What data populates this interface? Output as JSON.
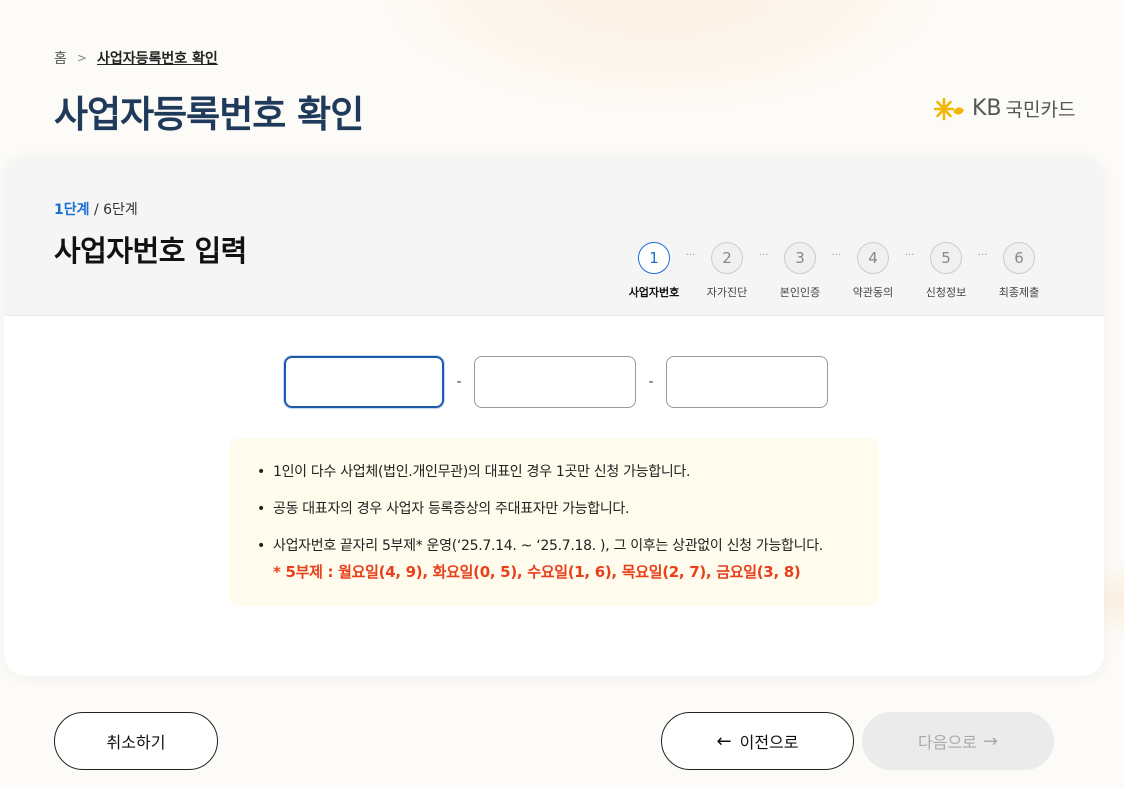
{
  "breadcrumb": {
    "home": "홈",
    "current": "사업자등록번호 확인"
  },
  "page_title": "사업자등록번호 확인",
  "logo": {
    "kb": "KB",
    "name": "국민카드"
  },
  "step_info": {
    "current": "1단계",
    "total": "/ 6단계"
  },
  "section_title": "사업자번호 입력",
  "stepper": [
    {
      "num": "1",
      "label": "사업자번호",
      "active": true
    },
    {
      "num": "2",
      "label": "자가진단",
      "active": false
    },
    {
      "num": "3",
      "label": "본인인증",
      "active": false
    },
    {
      "num": "4",
      "label": "약관동의",
      "active": false
    },
    {
      "num": "5",
      "label": "신청정보",
      "active": false
    },
    {
      "num": "6",
      "label": "최종제출",
      "active": false
    }
  ],
  "inputs": {
    "separator": "-",
    "first_value": "",
    "second_value": "",
    "third_value": ""
  },
  "notices": [
    "1인이 다수 사업체(법인.개인무관)의 대표인 경우 1곳만 신청 가능합니다.",
    "공동 대표자의 경우 사업자 등록증상의 주대표자만 가능합니다.",
    "사업자번호 끝자리 5부제* 운영(‘25.7.14. ~ ‘25.7.18. ), 그 이후는 상관없이 신청 가능합니다."
  ],
  "notice_highlight": "* 5부제 : 월요일(4, 9), 화요일(0, 5), 수요일(1, 6), 목요일(2, 7), 금요일(3, 8)",
  "buttons": {
    "cancel": "취소하기",
    "prev": "이전으로",
    "next": "다음으로"
  },
  "colors": {
    "title": "#1f3a5a",
    "accent": "#1b6fd3",
    "highlight": "#e8401c",
    "logo_star": "#f2b705"
  }
}
